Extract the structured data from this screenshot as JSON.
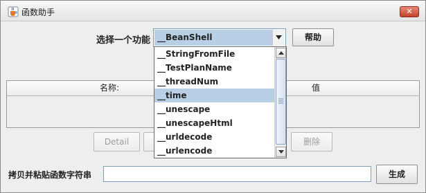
{
  "window": {
    "title": "函数助手",
    "icons": {
      "app": "java-cup-icon",
      "close": "close-icon"
    },
    "colors": {
      "selection": "#b8cfe5",
      "close_button": "#c4412a"
    }
  },
  "function_select": {
    "label": "选择一个功能",
    "selected": "__BeanShell",
    "dropdown_items": [
      "__StringFromFile",
      "__TestPlanName",
      "__threadNum",
      "__time",
      "__unescape",
      "__unescapeHtml",
      "__urldecode",
      "__urlencode"
    ],
    "highlighted_item": "__time"
  },
  "help_button": "帮助",
  "table": {
    "columns": [
      "名称:",
      "值"
    ]
  },
  "buttons": {
    "detail": "Detail",
    "delete": "删除"
  },
  "copy_paste": {
    "label": "拷贝并粘贴函数字符串",
    "value": "",
    "generate": "生成"
  }
}
